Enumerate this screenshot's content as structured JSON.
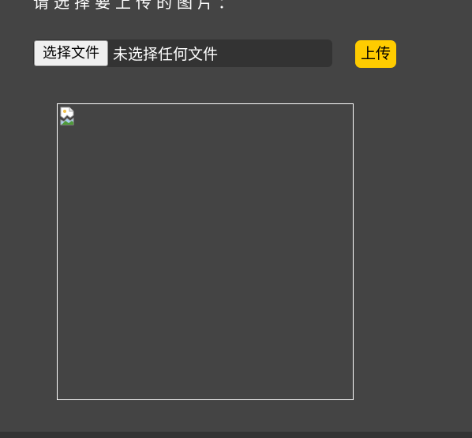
{
  "heading": {
    "text": "请选择要上传的图片："
  },
  "file_input": {
    "button_label": "选择文件",
    "status_text": "未选择任何文件"
  },
  "upload_button": {
    "label": "上传"
  },
  "preview": {
    "image_state": "broken-image-icon"
  },
  "colors": {
    "background": "#444444",
    "file_row_background": "#333333",
    "upload_button": "#ffcc00",
    "text": "#ffffff"
  }
}
